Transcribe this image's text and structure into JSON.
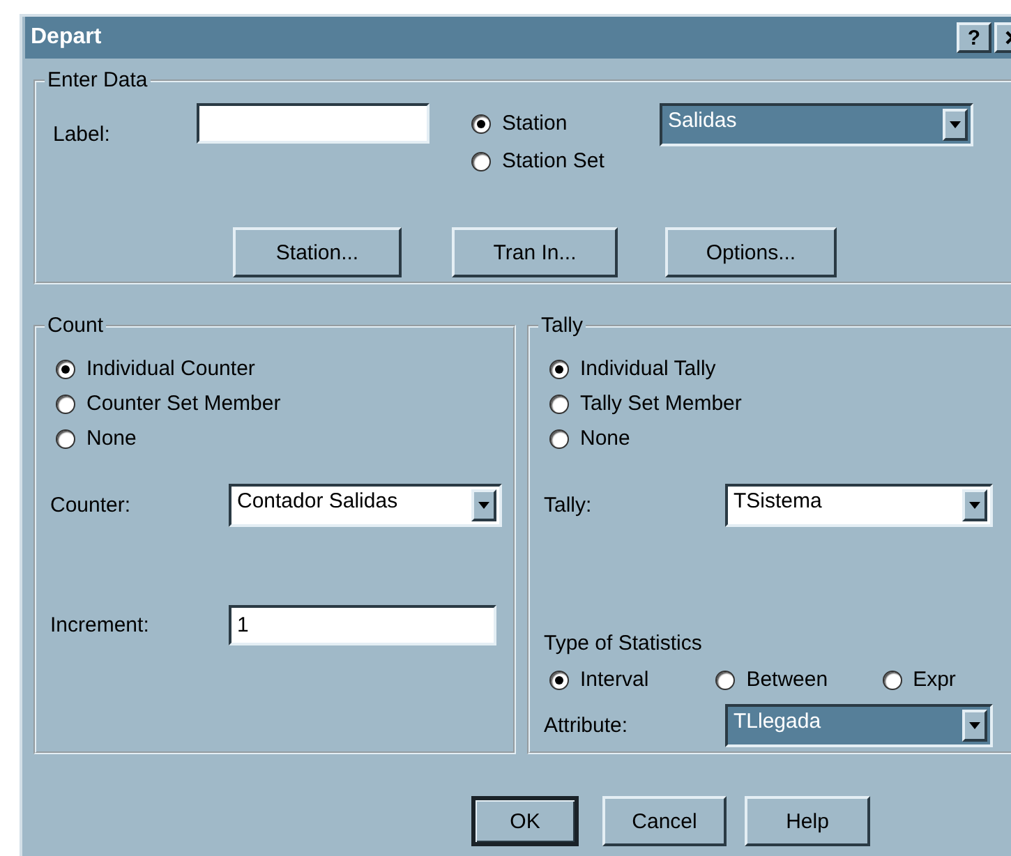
{
  "window": {
    "title": "Depart",
    "help_button": "?"
  },
  "enter_data": {
    "title": "Enter Data",
    "label": "Label:",
    "source_options": [
      {
        "label": "Station",
        "selected": true
      },
      {
        "label": "Station Set",
        "selected": false
      }
    ],
    "station_dropdown": {
      "value": "Salidas",
      "highlighted": true
    },
    "buttons": [
      "Station...",
      "Tran In...",
      "Options..."
    ]
  },
  "count": {
    "title": "Count",
    "options": [
      {
        "label": "Individual Counter",
        "selected": true
      },
      {
        "label": "Counter Set Member",
        "selected": false
      },
      {
        "label": "None",
        "selected": false
      }
    ],
    "counter": {
      "label": "Counter:",
      "value": "Contador Salidas",
      "highlighted": false
    },
    "increment": {
      "label": "Increment:",
      "value": "1"
    }
  },
  "tally": {
    "title": "Tally",
    "options": [
      {
        "label": "Individual Tally",
        "selected": true
      },
      {
        "label": "Tally Set Member",
        "selected": false
      },
      {
        "label": "None",
        "selected": false
      }
    ],
    "tally_dropdown": {
      "label": "Tally:",
      "value": "TSistema",
      "highlighted": false
    },
    "statistics": {
      "title": "Type of Statistics",
      "options": [
        {
          "label": "Interval",
          "selected": true
        },
        {
          "label": "Between",
          "selected": false
        },
        {
          "label": "Expr",
          "selected": false
        }
      ]
    },
    "attribute": {
      "label": "Attribute:",
      "value": "TLlegada",
      "highlighted": true
    }
  },
  "buttons": [
    {
      "label": "OK",
      "default": true
    },
    {
      "label": "Cancel",
      "default": false
    },
    {
      "label": "Help",
      "default": false
    }
  ]
}
